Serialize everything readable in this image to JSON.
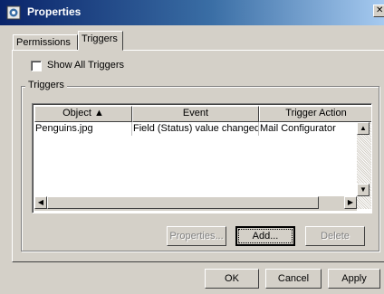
{
  "window": {
    "title": "Properties",
    "icons": {
      "app": "properties-icon",
      "close": "close-icon"
    }
  },
  "tabs": [
    {
      "label": "Permissions"
    },
    {
      "label": "Triggers"
    }
  ],
  "show_all": {
    "label": "Show All Triggers",
    "checked": false
  },
  "triggers_group": {
    "label": "Triggers"
  },
  "table": {
    "columns": [
      {
        "label": "Object ▲"
      },
      {
        "label": "Event"
      },
      {
        "label": "Trigger Action"
      }
    ],
    "rows": [
      {
        "object": "Penguins.jpg",
        "event": "Field (Status) value changed",
        "action": "Mail Configurator"
      }
    ]
  },
  "group_buttons": {
    "properties": "Properties...",
    "add": "Add...",
    "delete": "Delete"
  },
  "dialog_buttons": {
    "ok": "OK",
    "cancel": "Cancel",
    "apply": "Apply"
  }
}
